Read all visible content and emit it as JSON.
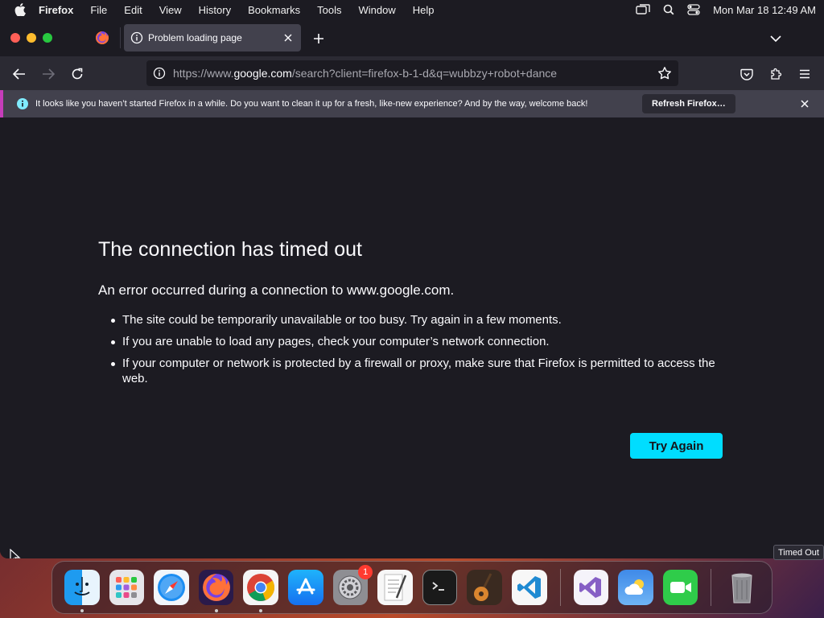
{
  "menubar": {
    "app_name": "Firefox",
    "menus": [
      "File",
      "Edit",
      "View",
      "History",
      "Bookmarks",
      "Tools",
      "Window",
      "Help"
    ],
    "clock": "Mon Mar 18  12:49 AM"
  },
  "tabs": {
    "active_title": "Problem loading page"
  },
  "urlbar": {
    "url_prefix": "https://www.",
    "url_host": "google.com",
    "url_suffix": "/search?client=firefox-b-1-d&q=wubbzy+robot+dance"
  },
  "notice": {
    "message": "It looks like you haven’t started Firefox in a while. Do you want to clean it up for a fresh, like-new experience? And by the way, welcome back!",
    "button_label": "Refresh Firefox…"
  },
  "error_page": {
    "title": "The connection has timed out",
    "subtitle": "An error occurred during a connection to www.google.com.",
    "bullets": [
      "The site could be temporarily unavailable or too busy. Try again in a few moments.",
      "If you are unable to load any pages, check your computer’s network connection.",
      "If your computer or network is protected by a firewall or proxy, make sure that Firefox is permitted to access the web."
    ],
    "try_again_label": "Try Again"
  },
  "tooltip": "Timed Out",
  "dock": {
    "settings_badge": "1",
    "items": [
      "finder-icon",
      "launchpad-icon",
      "safari-icon",
      "firefox-icon",
      "chrome-icon",
      "app-store-icon",
      "system-settings-icon",
      "textedit-icon",
      "terminal-icon",
      "garageband-icon",
      "vscode-icon",
      "visual-studio-icon",
      "weather-icon",
      "facetime-icon",
      "trash-icon"
    ]
  }
}
